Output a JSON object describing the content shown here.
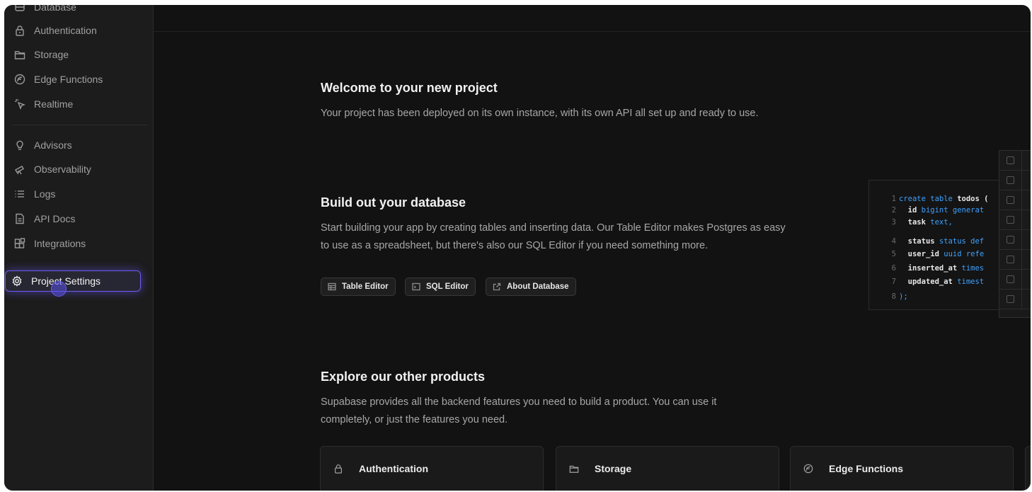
{
  "sidebar": {
    "items": [
      {
        "label": "Database",
        "icon": "database-icon"
      },
      {
        "label": "Authentication",
        "icon": "lock-icon"
      },
      {
        "label": "Storage",
        "icon": "folder-icon"
      },
      {
        "label": "Edge Functions",
        "icon": "functions-icon"
      },
      {
        "label": "Realtime",
        "icon": "cursor-click-icon"
      },
      {
        "label": "Advisors",
        "icon": "lightbulb-icon"
      },
      {
        "label": "Observability",
        "icon": "telescope-icon"
      },
      {
        "label": "Logs",
        "icon": "list-icon"
      },
      {
        "label": "API Docs",
        "icon": "file-text-icon"
      },
      {
        "label": "Integrations",
        "icon": "blocks-icon"
      },
      {
        "label": "Project Settings",
        "icon": "gear-icon"
      }
    ],
    "active_item": "Project Settings"
  },
  "welcome": {
    "title": "Welcome to your new project",
    "description": "Your project has been deployed on its own instance, with its own API all set up and ready to use."
  },
  "database": {
    "title": "Build out your database",
    "description_line1": "Start building your app by creating tables and inserting data. Our Table Editor makes Postgres as easy",
    "description_line2": "to use as a spreadsheet, but there's also our SQL Editor if you need something more.",
    "buttons": {
      "table_editor": "Table Editor",
      "sql_editor": "SQL Editor",
      "about_database": "About Database"
    }
  },
  "code": {
    "lines": [
      {
        "n": "1",
        "a": "create table ",
        "b": "todos",
        "c": " ("
      },
      {
        "n": "2",
        "a": "  ",
        "b": "id",
        "c": " bigint generat"
      },
      {
        "n": "3",
        "a": "  ",
        "b": "task",
        "c": " text,"
      },
      {
        "n": "4",
        "a": "  ",
        "b": "status",
        "c": " status def"
      },
      {
        "n": "5",
        "a": "  ",
        "b": "user_id",
        "c": " uuid refe"
      },
      {
        "n": "6",
        "a": "  ",
        "b": "inserted_at",
        "c": " times"
      },
      {
        "n": "7",
        "a": "  ",
        "b": "updated_at",
        "c": " timest"
      },
      {
        "n": "8",
        "a": ");",
        "b": "",
        "c": ""
      }
    ]
  },
  "products": {
    "title": "Explore our other products",
    "description_line1": "Supabase provides all the backend features you need to build a product. You can use it",
    "description_line2": "completely, or just the features you need.",
    "cards": [
      {
        "label": "Authentication",
        "icon": "lock-icon"
      },
      {
        "label": "Storage",
        "icon": "folder-icon"
      },
      {
        "label": "Edge Functions",
        "icon": "functions-icon"
      }
    ]
  },
  "colors": {
    "background": "#121212",
    "sidebar": "#1c1c1c",
    "accent": "#6d5cf3",
    "code_keyword": "#3ea1ff"
  }
}
